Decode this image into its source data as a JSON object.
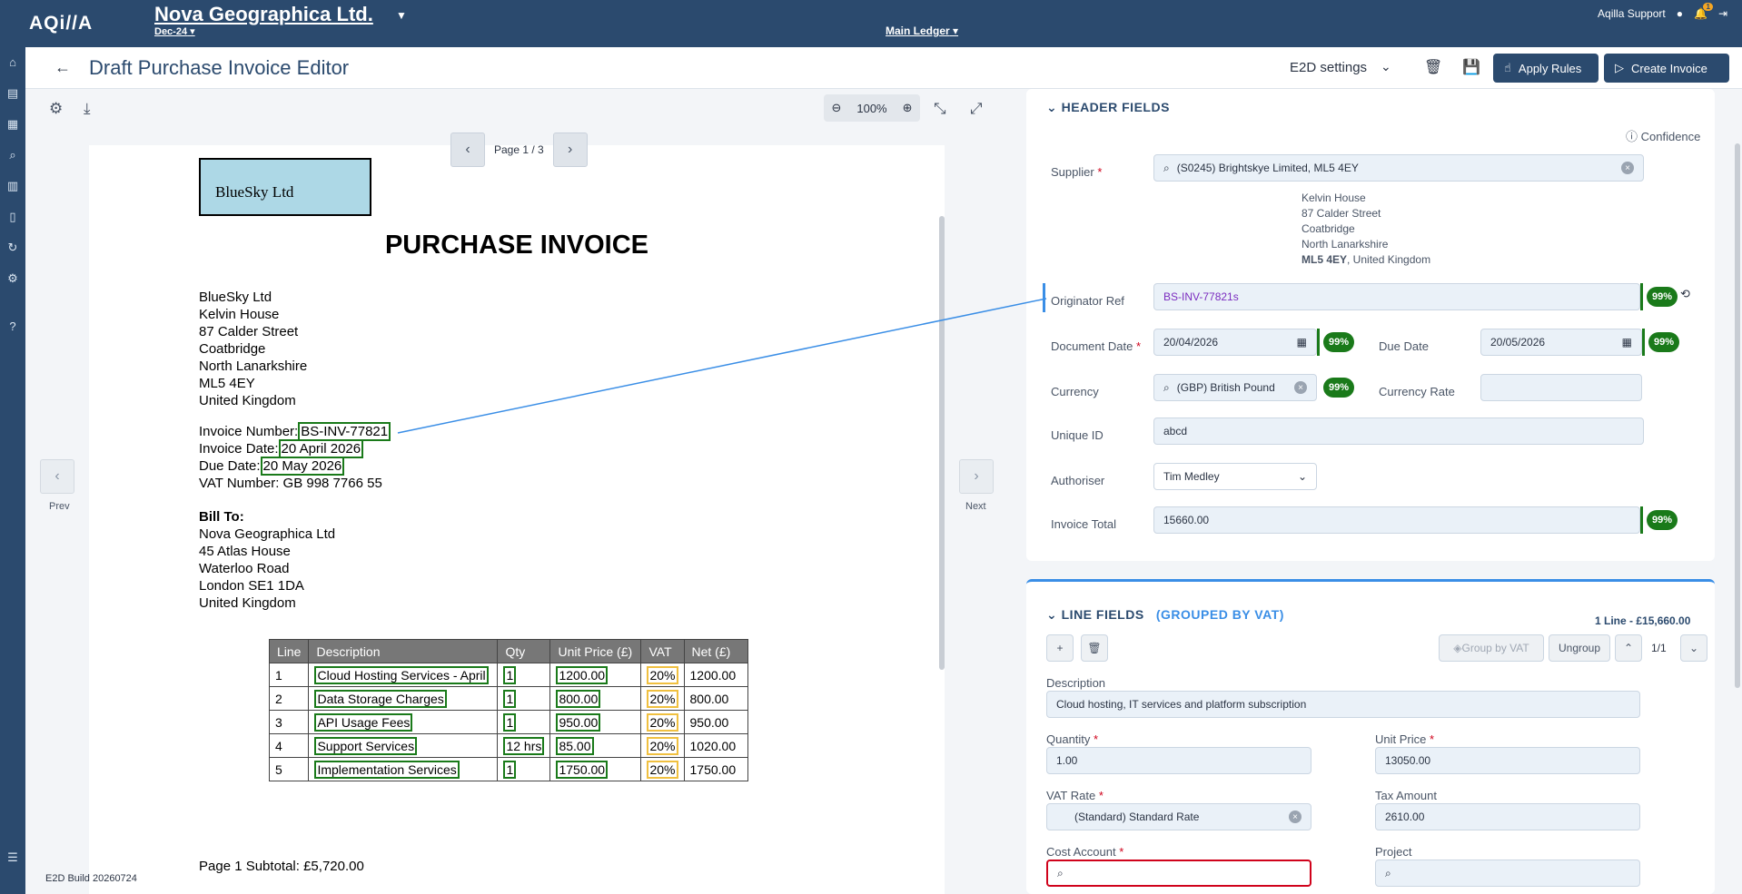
{
  "app": {
    "logo": "AQi//A",
    "company": "Nova Geographica Ltd.",
    "period": "Dec-24",
    "ledger": "Main Ledger",
    "user": "Aqilla Support",
    "notifications": "1"
  },
  "titlebar": {
    "title": "Draft Purchase Invoice Editor",
    "settings_select": "E2D settings",
    "apply_rules": "Apply Rules",
    "create_invoice": "Create Invoice"
  },
  "viewer": {
    "zoom": "100%",
    "page_label": "Page 1 / 3",
    "prev_label": "Prev",
    "next_label": "Next",
    "build": "E2D Build 20260724"
  },
  "document": {
    "logo_text": "BlueSky Ltd",
    "title": "PURCHASE INVOICE",
    "supplier_lines": [
      "BlueSky Ltd",
      "Kelvin House",
      "87 Calder Street",
      "Coatbridge",
      "North Lanarkshire",
      "ML5 4EY",
      "United Kingdom"
    ],
    "invoice_number_label": "Invoice Number:",
    "invoice_number": "BS-INV-77821",
    "invoice_date_label": "Invoice Date:",
    "invoice_date": "20 April 2026",
    "due_date_label": "Due Date:",
    "due_date": "20 May 2026",
    "vat_number": "VAT Number: GB 998 7766 55",
    "bill_to_label": "Bill To:",
    "bill_to_lines": [
      "Nova Geographica Ltd",
      "45 Atlas House",
      "Waterloo Road",
      "London SE1 1DA",
      "United Kingdom"
    ],
    "table_headers": [
      "Line",
      "Description",
      "Qty",
      "Unit Price (£)",
      "VAT",
      "Net (£)"
    ],
    "rows": [
      [
        "1",
        "Cloud Hosting Services - April",
        "1",
        "1200.00",
        "20%",
        "1200.00"
      ],
      [
        "2",
        "Data Storage Charges",
        "1",
        "800.00",
        "20%",
        "800.00"
      ],
      [
        "3",
        "API Usage Fees",
        "1",
        "950.00",
        "20%",
        "950.00"
      ],
      [
        "4",
        "Support Services",
        "12 hrs",
        "85.00",
        "20%",
        "1020.00"
      ],
      [
        "5",
        "Implementation Services",
        "1",
        "1750.00",
        "20%",
        "1750.00"
      ]
    ],
    "subtotal": "Page 1 Subtotal: £5,720.00"
  },
  "header_fields": {
    "section_title": "HEADER FIELDS",
    "confidence_label": "Confidence",
    "supplier_label": "Supplier",
    "supplier_value": "(S0245) Brightskye Limited, ML5 4EY",
    "supplier_address": [
      "Kelvin House",
      "87 Calder Street",
      "Coatbridge",
      "North Lanarkshire"
    ],
    "supplier_postcode": "ML5 4EY",
    "supplier_country": ", United Kingdom",
    "originator_ref_label": "Originator Ref",
    "originator_ref_value": "BS-INV-77821s",
    "document_date_label": "Document Date",
    "document_date_value": "20/04/2026",
    "due_date_label": "Due Date",
    "due_date_value": "20/05/2026",
    "currency_label": "Currency",
    "currency_value": "(GBP) British Pound(B",
    "currency_rate_label": "Currency Rate",
    "currency_rate_value": "",
    "unique_id_label": "Unique ID",
    "unique_id_value": "abcd",
    "authoriser_label": "Authoriser",
    "authoriser_value": "Tim Medley",
    "invoice_total_label": "Invoice Total",
    "invoice_total_value": "15660.00",
    "confidence_value": "99%"
  },
  "line_fields": {
    "section_title": "LINE FIELDS",
    "group_label": "(GROUPED BY VAT)",
    "summary": "1 Line - £15,660.00",
    "group_by_vat": "Group by VAT",
    "ungroup": "Ungroup",
    "pager": "1/1",
    "description_label": "Description",
    "description_value": "Cloud hosting, IT services and platform subscription",
    "quantity_label": "Quantity",
    "quantity_value": "1.00",
    "unit_price_label": "Unit Price",
    "unit_price_value": "13050.00",
    "vat_rate_label": "VAT Rate",
    "vat_rate_value": "(Standard) Standard Rate",
    "tax_amount_label": "Tax Amount",
    "tax_amount_value": "2610.00",
    "cost_account_label": "Cost Account",
    "project_label": "Project"
  },
  "colors": {
    "brand": "#2b4a6e",
    "confidence": "#1a7a1a",
    "link": "#3a8ee6",
    "error": "#d0021b"
  }
}
